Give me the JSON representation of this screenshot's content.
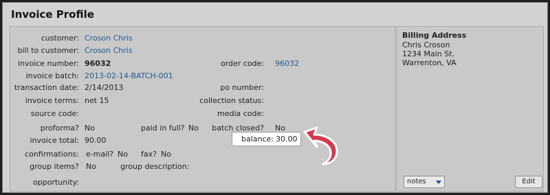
{
  "title": "Invoice Profile",
  "fields": {
    "customer": {
      "label": "customer:",
      "value": "Croson Chris"
    },
    "bill_to_customer": {
      "label": "bill to customer:",
      "value": "Croson Chris"
    },
    "invoice_number": {
      "label": "invoice number:",
      "value": "96032"
    },
    "order_code": {
      "label": "order code:",
      "value": "96032"
    },
    "invoice_batch": {
      "label": "invoice batch:",
      "value": "2013-02-14-BATCH-001"
    },
    "transaction_date": {
      "label": "transaction date:",
      "value": "2/14/2013"
    },
    "po_number": {
      "label": "po number:",
      "value": ""
    },
    "invoice_terms": {
      "label": "invoice terms:",
      "value": "net 15"
    },
    "collection_status": {
      "label": "collection status:",
      "value": ""
    },
    "source_code": {
      "label": "source code:",
      "value": ""
    },
    "media_code": {
      "label": "media code:",
      "value": ""
    },
    "proforma": {
      "label": "proforma?",
      "value": "No"
    },
    "paid_in_full": {
      "label": "paid in full?",
      "value": "No"
    },
    "batch_closed": {
      "label": "batch closed?",
      "value": "No"
    },
    "invoice_total": {
      "label": "invoice total:",
      "value": "90.00"
    },
    "balance": {
      "label": "balance:",
      "value": "30.00"
    },
    "confirmations": {
      "label": "confirmations:",
      "email_label": "e-mail?",
      "email_value": "No",
      "fax_label": "fax?",
      "fax_value": "No"
    },
    "group_items": {
      "label": "group items?",
      "value": "No"
    },
    "group_description": {
      "label": "group description:",
      "value": ""
    },
    "opportunity": {
      "label": "opportunity:",
      "value": ""
    }
  },
  "billing": {
    "title": "Billing Address",
    "name": "Chris Croson",
    "street": "1234 Main St.",
    "city_state": "Warrenton, VA"
  },
  "notes_select": {
    "value": "notes"
  },
  "edit_button": {
    "label": "Edit"
  },
  "colors": {
    "link": "#1f5a8f",
    "arrow": "#d23b4f"
  }
}
